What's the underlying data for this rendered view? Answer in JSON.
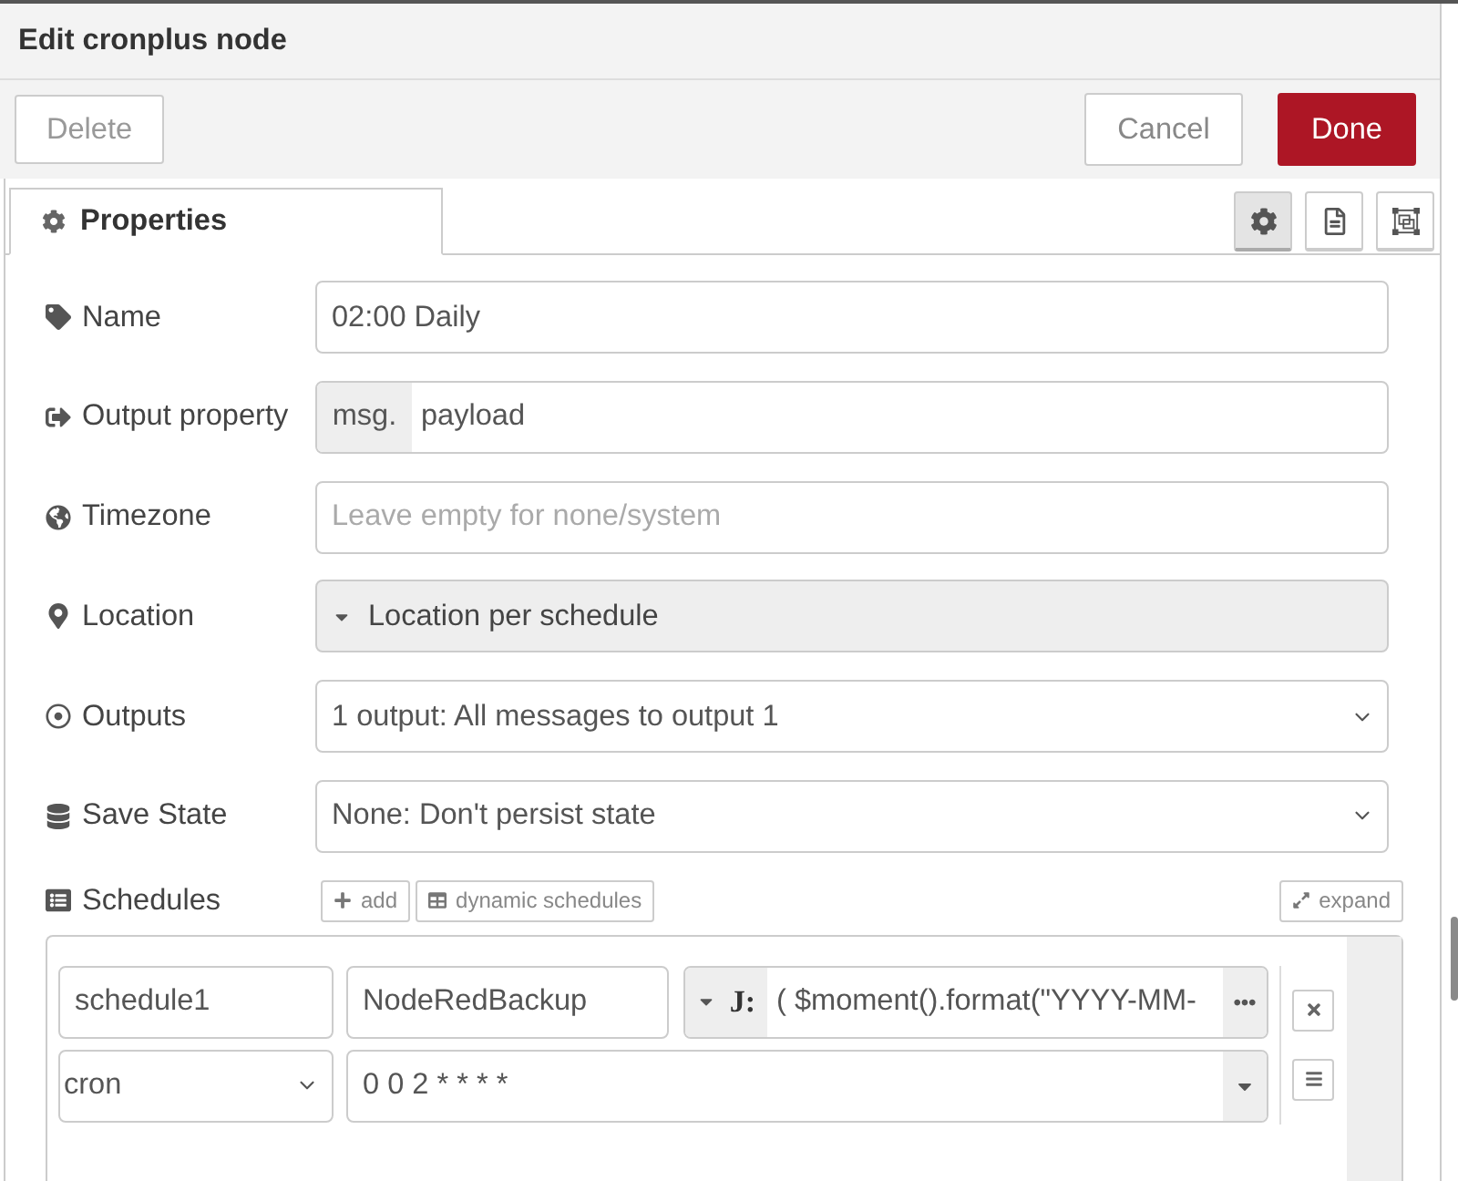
{
  "window": {
    "title": "Edit cronplus node"
  },
  "buttons": [
    {
      "label": "Delete",
      "kind": "delete"
    },
    {
      "label": "Cancel",
      "kind": "cancel"
    },
    {
      "label": "Done",
      "kind": "done"
    }
  ],
  "tabs": [
    {
      "label": "Properties",
      "selected": true
    }
  ],
  "tab_tools": [
    {
      "kind": "settings",
      "selected": true
    },
    {
      "kind": "description",
      "selected": false
    },
    {
      "kind": "appearance",
      "selected": false
    }
  ],
  "form": [
    {
      "label": "Name",
      "kind": "text",
      "value": "02:00 Daily"
    },
    {
      "label": "Output property",
      "kind": "typed",
      "type": "msg.",
      "value": "payload"
    },
    {
      "label": "Timezone",
      "kind": "text",
      "placeholder": "Leave empty for none/system"
    },
    {
      "label": "Location",
      "kind": "menu",
      "value": "Location per schedule"
    },
    {
      "label": "Outputs",
      "kind": "select",
      "value": "1 output: All messages to output 1"
    },
    {
      "label": "Save State",
      "kind": "select",
      "value": "None: Don't persist state"
    }
  ],
  "schedules": {
    "label": "Schedules",
    "add": "add",
    "dynamic": "dynamic schedules",
    "expand": "expand",
    "items": [
      {
        "name": "schedule1",
        "topic": "NodeRedBackup",
        "payload_type": "J:",
        "payload": "( $moment().format(\"YYYY-MM-",
        "type": "cron",
        "expression": "0 0 2 * * * *"
      }
    ]
  }
}
